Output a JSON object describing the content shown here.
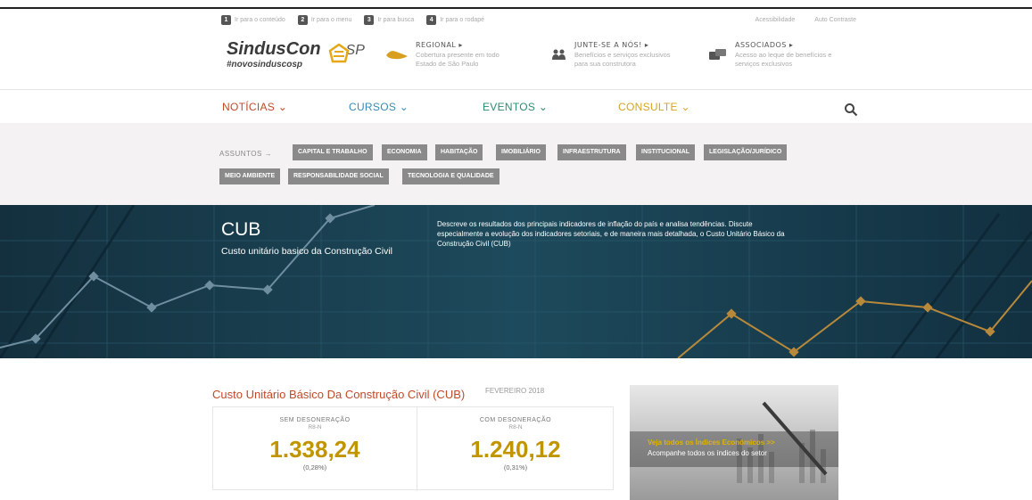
{
  "skip_links": [
    {
      "num": "1",
      "label": "Ir para o conteúdo"
    },
    {
      "num": "2",
      "label": "Ir para o menu"
    },
    {
      "num": "3",
      "label": "Ir para busca"
    },
    {
      "num": "4",
      "label": "Ir para o rodapé"
    }
  ],
  "top_links": {
    "accessibility": "Acessibilidade",
    "contrast": "Auto Contraste"
  },
  "logo": {
    "name": "SindusCon",
    "state": "SP",
    "tagline": "#novosinduscosp"
  },
  "header_blocks": [
    {
      "title": "REGIONAL ▸",
      "desc1": "Cobertura presente em todo",
      "desc2": "Estado de São Paulo",
      "icon": "map-icon"
    },
    {
      "title": "JUNTE-SE A NÓS! ▸",
      "desc1": "Benefícios e serviços exclusivos",
      "desc2": "para sua construtora",
      "icon": "people-icon"
    },
    {
      "title": "ASSOCIADOS ▸",
      "desc1": "Acesso ao leque de benefícios e",
      "desc2": "serviços exclusivos",
      "icon": "chat-icon"
    }
  ],
  "nav": [
    {
      "label": "NOTÍCIAS ⌄",
      "color": "#c0492a"
    },
    {
      "label": "CURSOS ⌄",
      "color": "#3a8ab2"
    },
    {
      "label": "EVENTOS ⌄",
      "color": "#2f8a73"
    },
    {
      "label": "CONSULTE ⌄",
      "color": "#d6a423"
    }
  ],
  "subjects": {
    "label": "ASSUNTOS →",
    "tags": [
      "CAPITAL E TRABALHO",
      "ECONOMIA",
      "HABITAÇÃO",
      "IMOBILIÁRIO",
      "INFRAESTRUTURA",
      "INSTITUCIONAL",
      "LEGISLAÇÃO/JURÍDICO",
      "MEIO AMBIENTE",
      "RESPONSABILIDADE SOCIAL",
      "TECNOLOGIA E QUALIDADE"
    ]
  },
  "hero": {
    "title": "CUB",
    "subtitle": "Custo unitário basico da Construção Civil",
    "desc1": "Descreve os resultados dos principais indicadores de inflação do país e analisa tendências. Discute",
    "desc2": "especialmente a evolução dos indicadores setoriais, e de maneira mais detalhada, o Custo Unitário Básico da",
    "desc3": "Construção Civil (CUB)"
  },
  "cub": {
    "title": "Custo Unitário Básico Da Construção Civil (CUB)",
    "date": "FEVEREIRO 2018",
    "cols": [
      {
        "label": "SEM DESONERAÇÃO",
        "sub": "R8-N",
        "value": "1.338,24",
        "pct": "(0,28%)"
      },
      {
        "label": "COM DESONERAÇÃO",
        "sub": "R8-N",
        "value": "1.240,12",
        "pct": "(0,31%)"
      }
    ]
  },
  "promo": {
    "link": "Veja todos os Índices Econômicos >>",
    "text": "Acompanhe todos os índices do setor"
  },
  "colors": {
    "accent_red": "#c0492a",
    "gold": "#c09500",
    "tag_gray": "#8a8a8a",
    "hero_bg": "#173848"
  }
}
